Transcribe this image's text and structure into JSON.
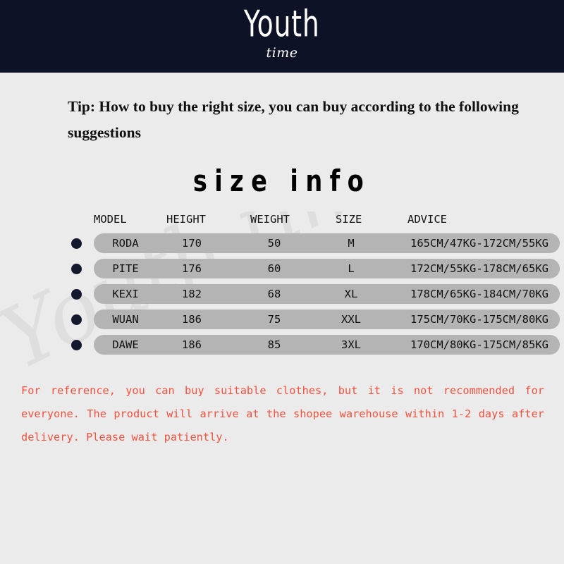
{
  "banner": {
    "title": "Youth",
    "subtitle": "time",
    "background_color": "#0d1226",
    "text_color": "#ffffff"
  },
  "watermark": {
    "text": "Youth time",
    "color": "#dedede"
  },
  "tip": {
    "text": "Tip: How to buy the right size, you can buy according to the following suggestions"
  },
  "size_info": {
    "heading": "size info",
    "columns": [
      "MODEL",
      "HEIGHT",
      "WEIGHT",
      "SIZE",
      "ADVICE"
    ],
    "rows": [
      {
        "model": "RODA",
        "height": "170",
        "weight": "50",
        "size": "M",
        "advice": "165CM/47KG-172CM/55KG"
      },
      {
        "model": "PITE",
        "height": "176",
        "weight": "60",
        "size": "L",
        "advice": "172CM/55KG-178CM/65KG"
      },
      {
        "model": "KEXI",
        "height": "182",
        "weight": "68",
        "size": "XL",
        "advice": "178CM/65KG-184CM/70KG"
      },
      {
        "model": "WUAN",
        "height": "186",
        "weight": "75",
        "size": "XXL",
        "advice": "175CM/70KG-175CM/80KG"
      },
      {
        "model": "DAWE",
        "height": "186",
        "weight": "85",
        "size": "3XL",
        "advice": "170CM/80KG-175CM/85KG"
      }
    ],
    "row_background_color": "#b4b4b4",
    "bullet_color": "#13182f"
  },
  "footer_note": {
    "text": "For reference, you can buy suitable clothes, but it is not recommended for everyone. The product will arrive at the shopee warehouse within 1-2 days after delivery. Please wait patiently.",
    "color": "#f4503c"
  },
  "page": {
    "background_color": "#ebebeb"
  }
}
